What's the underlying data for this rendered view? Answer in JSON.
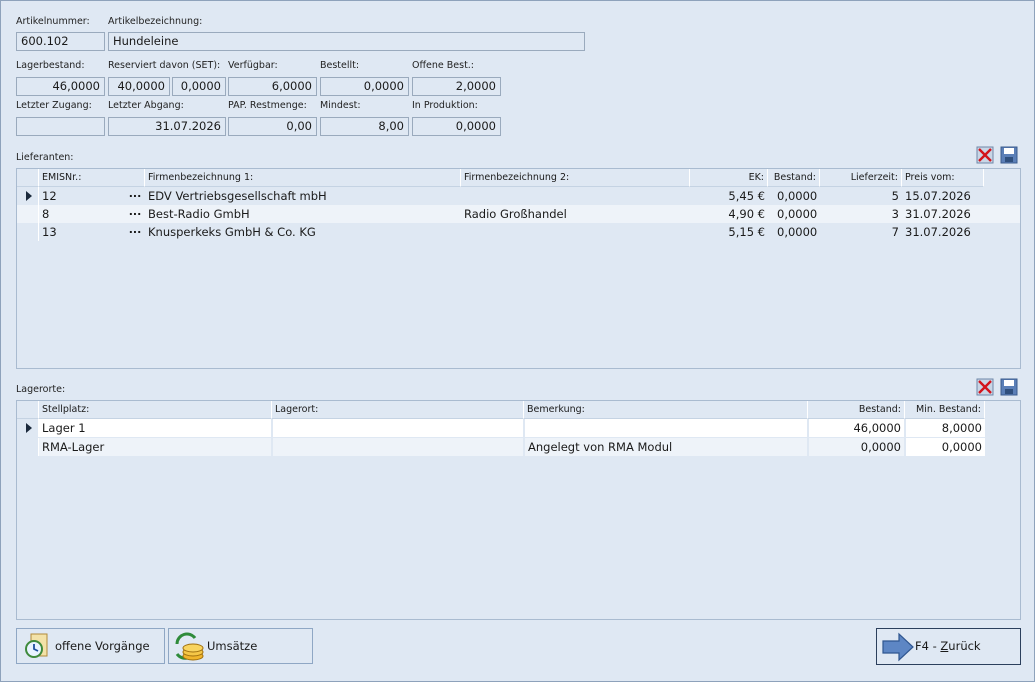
{
  "article": {
    "number_label": "Artikelnummer:",
    "number_value": "600.102",
    "name_label": "Artikelbezeichnung:",
    "name_value": "Hundeleine"
  },
  "stock": {
    "lagerbestand_label": "Lagerbestand:",
    "lagerbestand_value": "46,0000",
    "reserviert_label": "Reserviert davon (SET):",
    "reserviert_value": "40,0000",
    "set_value": "0,0000",
    "verfuegbar_label": "Verfügbar:",
    "verfuegbar_value": "6,0000",
    "bestellt_label": "Bestellt:",
    "bestellt_value": "0,0000",
    "offene_label": "Offene Best.:",
    "offene_value": "2,0000",
    "letzter_zugang_label": "Letzter Zugang:",
    "letzter_zugang_value": "",
    "letzter_abgang_label": "Letzter Abgang:",
    "letzter_abgang_value": "31.07.2026",
    "pap_label": "PAP. Restmenge:",
    "pap_value": "0,00",
    "mindest_label": "Mindest:",
    "mindest_value": "8,00",
    "produktion_label": "In Produktion:",
    "produktion_value": "0,0000"
  },
  "suppliers": {
    "section_label": "Lieferanten:",
    "headers": [
      "EMISNr.:",
      "Firmenbezeichnung 1:",
      "Firmenbezeichnung 2:",
      "EK:",
      "Bestand:",
      "Lieferzeit:",
      "Preis vom:"
    ],
    "ellipsis": "...",
    "rows": [
      {
        "nr": "12",
        "firma1": "EDV Vertriebsgesellschaft mbH",
        "firma2": "",
        "ek": "5,45 €",
        "bestand": "0,0000",
        "lieferzeit": "5",
        "preis_vom": "15.07.2026"
      },
      {
        "nr": "8",
        "firma1": "Best-Radio GmbH",
        "firma2": "Radio Großhandel",
        "ek": "4,90 €",
        "bestand": "0,0000",
        "lieferzeit": "3",
        "preis_vom": "31.07.2026"
      },
      {
        "nr": "13",
        "firma1": "Knusperkeks GmbH & Co. KG",
        "firma2": "",
        "ek": "5,15 €",
        "bestand": "0,0000",
        "lieferzeit": "7",
        "preis_vom": "31.07.2026"
      }
    ]
  },
  "locations": {
    "section_label": "Lagerorte:",
    "headers": [
      "Stellplatz:",
      "Lagerort:",
      "Bemerkung:",
      "Bestand:",
      "Min. Bestand:"
    ],
    "rows": [
      {
        "stellplatz": "Lager 1",
        "lagerort": "",
        "bemerkung": "",
        "bestand": "46,0000",
        "min": "8,0000"
      },
      {
        "stellplatz": "RMA-Lager",
        "lagerort": "",
        "bemerkung": "Angelegt von RMA Modul",
        "bestand": "0,0000",
        "min": "0,0000"
      }
    ]
  },
  "buttons": {
    "offene_vorgaenge": "offene Vorgänge",
    "umsaetze": "Umsätze",
    "zurueck_prefix": "F4 - ",
    "zurueck_underlined": "Z",
    "zurueck_rest": "urück"
  },
  "icons": {
    "delete": "delete-icon",
    "save": "save-icon",
    "history": "history-icon",
    "coins": "coins-icon",
    "arrow": "arrow-right-icon"
  }
}
